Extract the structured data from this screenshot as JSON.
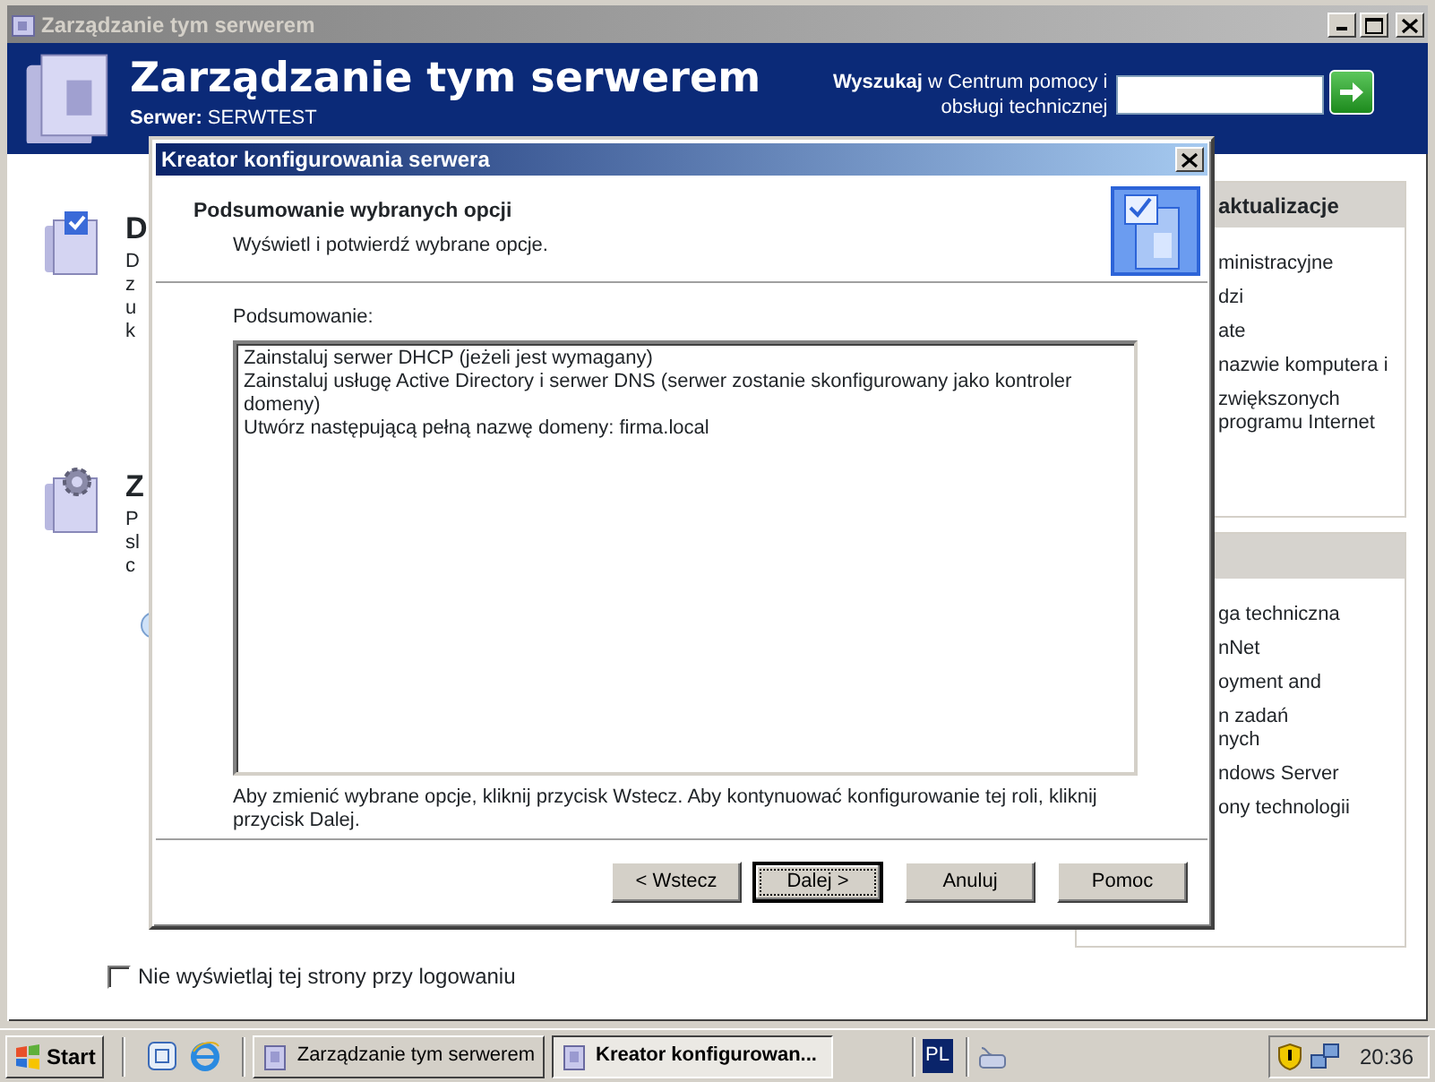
{
  "window": {
    "title": "Zarządzanie tym serwerem"
  },
  "header": {
    "title": "Zarządzanie tym serwerem",
    "server_label": "Serwer:",
    "server_name": "SERWTEST",
    "search_link": {
      "text": "Wyszukaj"
    },
    "search_lines": [
      "w Centrum pomocy i",
      "obsługi technicznej"
    ]
  },
  "sections": [
    {
      "heading": "D",
      "lines": [
        "D",
        "z",
        "u",
        "k"
      ]
    },
    {
      "heading": "Z",
      "lines": [
        "P",
        "sl",
        "c"
      ]
    }
  ],
  "side_panels": [
    {
      "heading": "aktualizacje",
      "items": [
        [
          "ministracyjne"
        ],
        [
          "dzi"
        ],
        [
          "ate"
        ],
        [
          "nazwie komputera i"
        ],
        [
          "zwiększonych",
          "programu Internet"
        ]
      ]
    },
    {
      "items": [
        [
          "ga techniczna"
        ],
        [
          "nNet"
        ],
        [
          "oyment and"
        ],
        [
          "n zadań",
          "nych"
        ],
        [
          "ndows Server"
        ],
        [
          "ony technologii"
        ]
      ]
    }
  ],
  "dialog": {
    "title": "Kreator konfigurowania serwera",
    "heading": "Podsumowanie wybranych opcji",
    "subheading": "Wyświetl i potwierdź wybrane opcje.",
    "summary_label": {
      "text": "Podsumowanie:"
    },
    "summary_lines": [
      "Zainstaluj serwer DHCP (jeżeli jest wymagany)",
      "Zainstaluj usługę Active Directory i serwer DNS (serwer zostanie skonfigurowany jako kontroler",
      "domeny)",
      "Utwórz następującą pełną nazwę domeny: firma.local"
    ],
    "note": "Aby zmienić wybrane opcje, kliknij przycisk Wstecz. Aby kontynuować konfigurowanie tej roli, kliknij przycisk Dalej.",
    "buttons": [
      {
        "label": "< Wstecz",
        "default": false
      },
      {
        "label": "Dalej >",
        "default": true
      },
      {
        "label": "Anuluj",
        "default": false
      },
      {
        "label": "Pomoc",
        "default": false
      }
    ]
  },
  "startup_checkbox": {
    "label": "Nie wyświetlaj tej strony przy logowaniu",
    "checked": false
  },
  "taskbar": {
    "start": "Start",
    "tasks": [
      {
        "label": "Zarządzanie tym serwerem",
        "selected": false
      },
      {
        "label": "Kreator konfigurowan...",
        "selected": true
      }
    ],
    "language": "PL",
    "clock": "20:36"
  }
}
